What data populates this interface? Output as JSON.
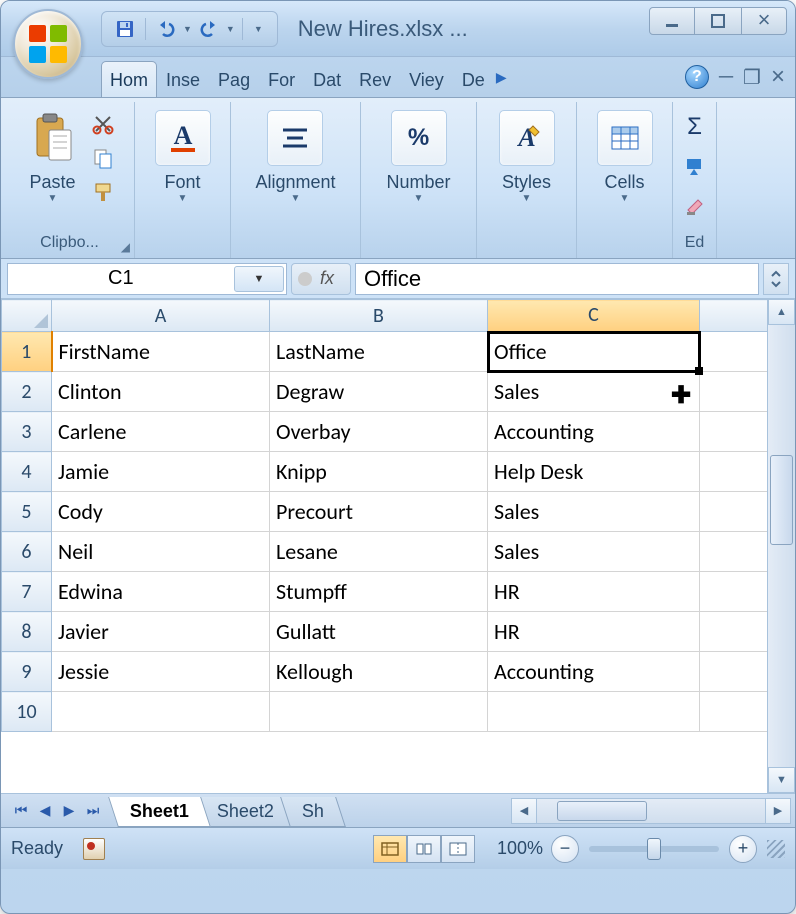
{
  "window": {
    "title": "New Hires.xlsx ..."
  },
  "qat": {
    "save": "Save",
    "undo": "Undo",
    "redo": "Redo"
  },
  "tabs": {
    "items": [
      "Hom",
      "Inse",
      "Pag",
      "For",
      "Dat",
      "Rev",
      "Viey",
      "De"
    ],
    "active": 0
  },
  "ribbon": {
    "clipboard": {
      "label": "Clipbo...",
      "paste": "Paste"
    },
    "font": {
      "label": "Font"
    },
    "alignment": {
      "label": "Alignment"
    },
    "number": {
      "label": "Number"
    },
    "styles": {
      "label": "Styles"
    },
    "cells": {
      "label": "Cells"
    },
    "editing": {
      "label": "Ed"
    }
  },
  "formula": {
    "name_box": "C1",
    "fx": "fx",
    "value": "Office"
  },
  "sheet": {
    "columns": [
      "A",
      "B",
      "C"
    ],
    "selected_col": 2,
    "selected_row": 0,
    "rows": [
      {
        "n": "1",
        "cells": [
          "FirstName",
          "LastName",
          "Office"
        ]
      },
      {
        "n": "2",
        "cells": [
          "Clinton",
          "Degraw",
          "Sales"
        ]
      },
      {
        "n": "3",
        "cells": [
          "Carlene",
          "Overbay",
          "Accounting"
        ]
      },
      {
        "n": "4",
        "cells": [
          "Jamie",
          "Knipp",
          "Help Desk"
        ]
      },
      {
        "n": "5",
        "cells": [
          "Cody",
          "Precourt",
          "Sales"
        ]
      },
      {
        "n": "6",
        "cells": [
          "Neil",
          "Lesane",
          "Sales"
        ]
      },
      {
        "n": "7",
        "cells": [
          "Edwina",
          "Stumpff",
          "HR"
        ]
      },
      {
        "n": "8",
        "cells": [
          "Javier",
          "Gullatt",
          "HR"
        ]
      },
      {
        "n": "9",
        "cells": [
          "Jessie",
          "Kellough",
          "Accounting"
        ]
      },
      {
        "n": "10",
        "cells": [
          "",
          "",
          ""
        ]
      }
    ]
  },
  "sheet_tabs": {
    "items": [
      "Sheet1",
      "Sheet2",
      "Sh"
    ],
    "active": 0
  },
  "status": {
    "text": "Ready",
    "zoom": "100%"
  }
}
